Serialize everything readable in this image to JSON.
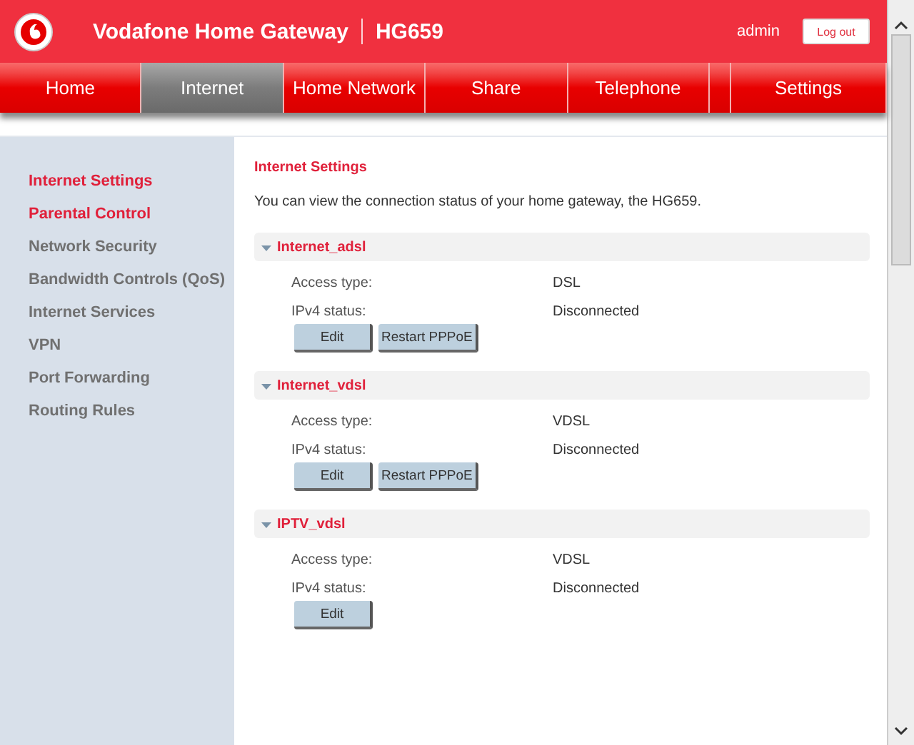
{
  "header": {
    "brand": "Vodafone Home Gateway",
    "model": "HG659",
    "user": "admin",
    "logout": "Log out"
  },
  "tabs": [
    {
      "label": "Home",
      "selected": false
    },
    {
      "label": "Internet",
      "selected": true
    },
    {
      "label": "Home Network",
      "selected": false
    },
    {
      "label": "Share",
      "selected": false
    },
    {
      "label": "Telephone",
      "selected": false
    },
    {
      "label": "Settings",
      "selected": false
    }
  ],
  "sidebar": {
    "items": [
      {
        "label": "Internet Settings",
        "selected": true
      },
      {
        "label": "Parental Control",
        "selected": true
      },
      {
        "label": "Network Security",
        "selected": false
      },
      {
        "label": "Bandwidth Controls (QoS)",
        "selected": false
      },
      {
        "label": "Internet Services",
        "selected": false
      },
      {
        "label": "VPN",
        "selected": false
      },
      {
        "label": "Port Forwarding",
        "selected": false
      },
      {
        "label": "Routing Rules",
        "selected": false
      }
    ]
  },
  "main": {
    "title": "Internet Settings",
    "description": "You can view the connection status of your home gateway, the HG659.",
    "connections": [
      {
        "name": "Internet_adsl",
        "expanded": true,
        "fields": [
          {
            "label": "Access type:",
            "value": "DSL"
          },
          {
            "label": "IPv4 status:",
            "value": "Disconnected"
          }
        ],
        "buttons": [
          "Edit",
          "Restart PPPoE"
        ]
      },
      {
        "name": "Internet_vdsl",
        "expanded": true,
        "fields": [
          {
            "label": "Access type:",
            "value": "VDSL"
          },
          {
            "label": "IPv4 status:",
            "value": "Disconnected"
          }
        ],
        "buttons": [
          "Edit",
          "Restart PPPoE"
        ]
      },
      {
        "name": "IPTV_vdsl",
        "expanded": true,
        "fields": [
          {
            "label": "Access type:",
            "value": "VDSL"
          },
          {
            "label": "IPv4 status:",
            "value": "Disconnected"
          }
        ],
        "buttons": [
          "Edit"
        ]
      }
    ]
  }
}
